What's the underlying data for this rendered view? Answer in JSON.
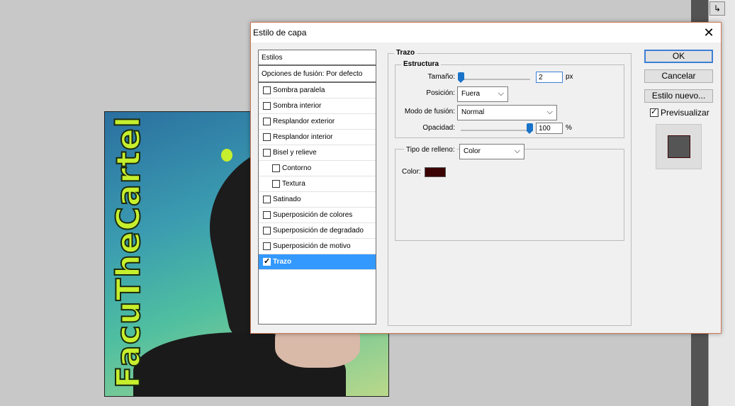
{
  "background": {
    "canvas_text": "FacuTheCartel"
  },
  "dialog": {
    "title": "Estilo de capa",
    "styles_header": "Estilos",
    "blend_options": "Opciones de fusión: Por defecto",
    "style_items": [
      {
        "label": "Sombra paralela",
        "checked": false,
        "indent": false
      },
      {
        "label": "Sombra interior",
        "checked": false,
        "indent": false
      },
      {
        "label": "Resplandor exterior",
        "checked": false,
        "indent": false
      },
      {
        "label": "Resplandor interior",
        "checked": false,
        "indent": false
      },
      {
        "label": "Bisel y relieve",
        "checked": false,
        "indent": false
      },
      {
        "label": "Contorno",
        "checked": false,
        "indent": true
      },
      {
        "label": "Textura",
        "checked": false,
        "indent": true
      },
      {
        "label": "Satinado",
        "checked": false,
        "indent": false
      },
      {
        "label": "Superposición de colores",
        "checked": false,
        "indent": false
      },
      {
        "label": "Superposición de degradado",
        "checked": false,
        "indent": false
      },
      {
        "label": "Superposición de motivo",
        "checked": false,
        "indent": false
      },
      {
        "label": "Trazo",
        "checked": true,
        "indent": false,
        "selected": true
      }
    ],
    "section_title": "Trazo",
    "structure": {
      "title": "Estructura",
      "size_label": "Tamaño:",
      "size_value": "2",
      "size_unit": "px",
      "position_label": "Posición:",
      "position_value": "Fuera",
      "blend_label": "Modo de fusión:",
      "blend_value": "Normal",
      "opacity_label": "Opacidad:",
      "opacity_value": "100",
      "opacity_unit": "%"
    },
    "fill": {
      "type_label": "Tipo de relleno:",
      "type_value": "Color",
      "color_label": "Color:",
      "color_hex": "#3b0303"
    },
    "buttons": {
      "ok": "OK",
      "cancel": "Cancelar",
      "new_style": "Estilo nuevo...",
      "preview": "Previsualizar"
    }
  }
}
